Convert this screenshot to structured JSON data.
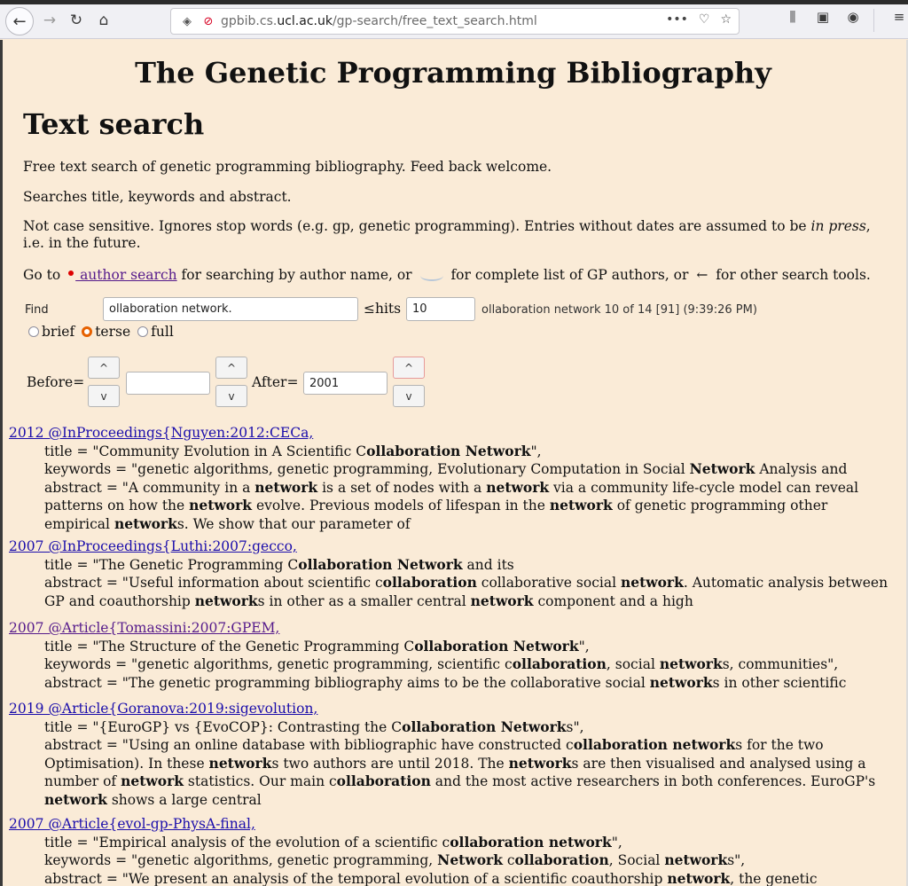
{
  "browser": {
    "url_prefix": "gpbib.cs.",
    "url_domain": "ucl.ac.uk",
    "url_path": "/gp-search/free_text_search.html",
    "more": "•••"
  },
  "page": {
    "title": "The Genetic Programming Bibliography",
    "heading": "Text search",
    "intro1": "Free text search of genetic programming bibliography. Feed back welcome.",
    "intro2": "Searches title, keywords and abstract.",
    "intro3_a": "Not case sensitive. Ignores stop words (e.g. gp, genetic programming). Entries without dates are assumed to be ",
    "intro3_em": "in press",
    "intro3_b": ", i.e. in the future.",
    "goto_a": "Go to ",
    "goto_link": " author search",
    "goto_b": " for searching by author name, or ",
    "goto_c": " for complete list of GP authors, or ",
    "goto_d": " for other search tools."
  },
  "form": {
    "find_label": "Find",
    "find_value": "ollaboration network.",
    "hits_label": "≤hits",
    "hits_value": "10",
    "status": "ollaboration network 10 of 14 [91] (9:39:26 PM)",
    "radio_brief": "brief",
    "radio_terse": "terse",
    "radio_full": "full",
    "before_label": "Before=",
    "before_value": "",
    "after_label": "After=",
    "after_value": "2001",
    "up": "^",
    "down": "v"
  },
  "results": [
    {
      "link": "2012 @InProceedings{Nguyen:2012:CECa,",
      "lines": [
        "title = \"Community Evolution in A Scientific C<b>ollaboration Network</b>\",",
        "keywords = \"genetic algorithms, genetic programming, Evolutionary Computation in Social <b>Network</b> Analysis and",
        "abstract = \"A community in a <b>network</b> is a set of nodes with a <b>network</b> via a community life-cycle model can reveal",
        "patterns on how the <b>network</b> evolve. Previous models of lifespan in the <b>network</b> of genetic programming other",
        "empirical <b>network</b>s. We show that our parameter of"
      ]
    },
    {
      "link": "2007 @InProceedings{Luthi:2007:gecco,",
      "lines": [
        "title = \"The Genetic Programming C<b>ollaboration Network</b> and its",
        "abstract = \"Useful information about scientific c<b>ollaboration</b> collaborative social <b>network</b>. Automatic analysis between",
        "GP and coauthorship <b>network</b>s in other as a smaller central <b>network</b> component and a high"
      ]
    },
    {
      "link": "2007 @Article{Tomassini:2007:GPEM,",
      "visited": true,
      "lines": [
        "title = \"The Structure of the Genetic Programming C<b>ollaboration Network</b>\",",
        "keywords = \"genetic algorithms, genetic programming, scientific c<b>ollaboration</b>, social <b>network</b>s, communities\",",
        "abstract = \"The genetic programming bibliography aims to be the collaborative social <b>network</b>s in other scientific"
      ]
    },
    {
      "link": "2019 @Article{Goranova:2019:sigevolution,",
      "lines": [
        "title = \"{EuroGP} vs {EvoCOP}: Contrasting the C<b>ollaboration Network</b>s\",",
        "abstract = \"Using an online database with bibliographic have constructed c<b>ollaboration network</b>s for the two",
        "Optimisation). In these <b>network</b>s two authors are until 2018. The <b>network</b>s are then visualised and analysed using a",
        "number of <b>network</b> statistics. Our main c<b>ollaboration</b> and the most active researchers in both conferences. EuroGP's",
        "<b>network</b> shows a large central"
      ]
    },
    {
      "link": "2007 @Article{evol-gp-PhysA-final,",
      "lines": [
        "title = \"Empirical analysis of the evolution of a scientific c<b>ollaboration network</b>\",",
        "keywords = \"genetic algorithms, genetic programming, <b>Network</b> c<b>ollaboration</b>, Social <b>network</b>s\",",
        "abstract = \"We present an analysis of the temporal evolution of a scientific coauthorship <b>network</b>, the genetic"
      ]
    }
  ]
}
